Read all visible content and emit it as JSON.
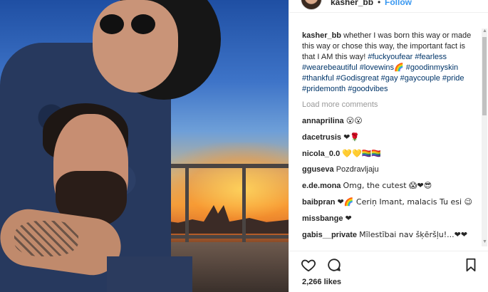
{
  "header": {
    "username": "kasher_bb",
    "separator": "•",
    "follow_label": "Follow"
  },
  "caption": {
    "username": "kasher_bb",
    "text": "whether I was born this way or made this way or chose this way, the important fact is that I AM this way!",
    "hashtags": "#fuckyoufear #fearless #wearebeautiful #lovewins🌈 #goodinmyskin #thankful #Godisgreat #gay #gaycouple #pride #pridemonth #goodvibes"
  },
  "load_more_label": "Load more comments",
  "comments": [
    {
      "user": "annaprilina",
      "text": "😮😮"
    },
    {
      "user": "dacetrusis",
      "text": "❤🌹"
    },
    {
      "user": "nicola_0.0",
      "text": "💛💛🏳️‍🌈🏳️‍🌈"
    },
    {
      "user": "gguseva",
      "text": "Pozdravljaju"
    },
    {
      "user": "e.de.mona",
      "text": "Omg, the cutest 😱❤😎"
    },
    {
      "user": "baibpran",
      "text": "❤🌈 Ceriņ Imant, malacis Tu esi 😉"
    },
    {
      "user": "missbange",
      "text": "❤"
    },
    {
      "user": "gabis__private",
      "text": "Mīlestībai nav šķēršļu!...❤❤"
    }
  ],
  "likes_label": "2,266 likes",
  "icons": {
    "like": "heart-outline-icon",
    "comment": "speech-bubble-icon",
    "save": "bookmark-icon"
  }
}
